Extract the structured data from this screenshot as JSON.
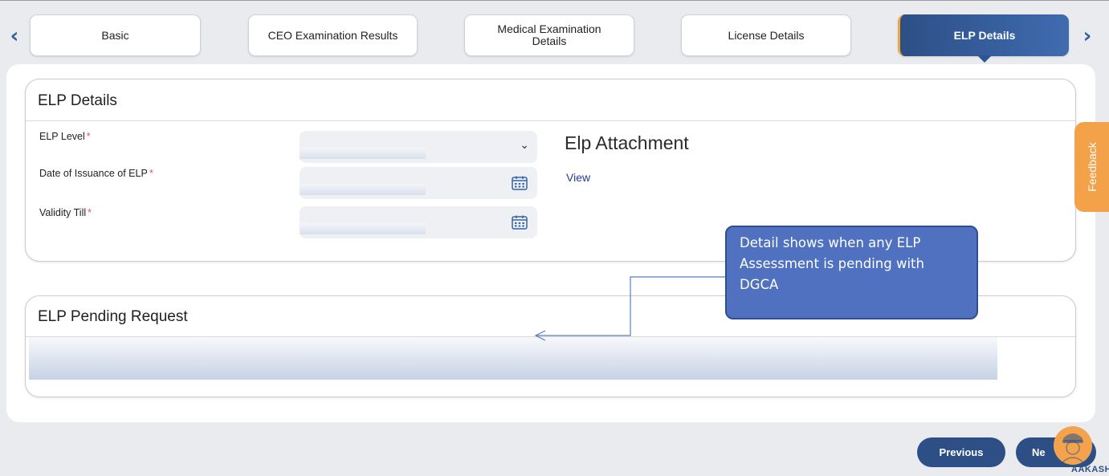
{
  "tabs": {
    "prev_arrow": "‹",
    "next_arrow": "›",
    "items": [
      {
        "label": "Basic"
      },
      {
        "label": "CEO Examination Results"
      },
      {
        "label": "Medical Examination Details"
      },
      {
        "label": "License Details"
      },
      {
        "label": "ELP Details",
        "active": true
      }
    ]
  },
  "elp_details": {
    "title": "ELP Details",
    "fields": [
      {
        "label": "ELP Level",
        "required_mark": "*",
        "type": "select",
        "icon": "chevron-down-icon",
        "value": ""
      },
      {
        "label": "Date of Issuance of ELP",
        "required_mark": "*",
        "type": "date",
        "icon": "calendar-icon",
        "value": ""
      },
      {
        "label": "Validity Till",
        "required_mark": "*",
        "type": "date",
        "icon": "calendar-icon",
        "value": ""
      }
    ],
    "attachment_title": "Elp Attachment",
    "view_link": "View"
  },
  "elp_pending": {
    "title": "ELP Pending Request"
  },
  "callout": {
    "text": "Detail shows when any ELP Assessment is pending with DGCA"
  },
  "feedback": {
    "label": "Feedback"
  },
  "footer": {
    "previous_label": "Previous",
    "next_label": "Ne",
    "assistant_label": "AAKASH"
  },
  "colors": {
    "accent": "#2d4f86",
    "active_tab_gradient_end": "#3f6bb0",
    "active_tab_marker": "#f0a640",
    "feedback": "#f4a24a",
    "callout": "#4f71c0",
    "required": "#e25555",
    "link": "#1f3d9c"
  }
}
